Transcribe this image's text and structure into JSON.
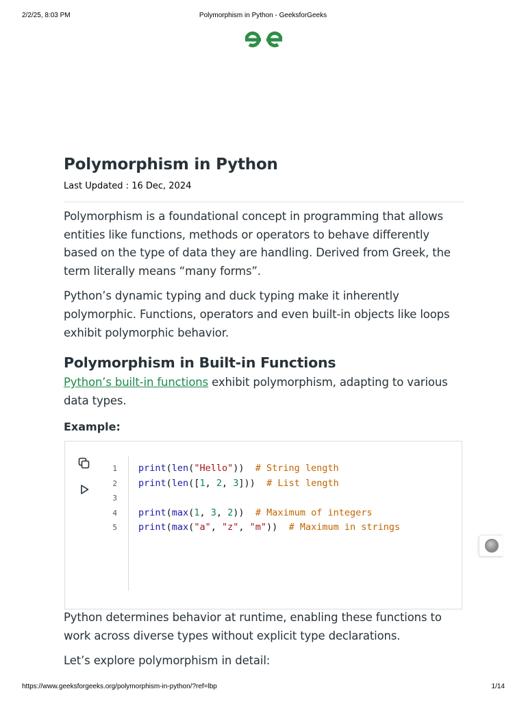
{
  "print_header": {
    "datetime": "2/2/25, 8:03 PM",
    "doc_title": "Polymorphism in Python - GeeksforGeeks"
  },
  "logo": {
    "icon": "geeksforgeeks-logo-icon",
    "color": "#2f8d46"
  },
  "article": {
    "title": "Polymorphism in Python",
    "last_updated": "Last Updated : 16 Dec, 2024",
    "paragraphs": [
      "Polymorphism is a foundational concept in programming that allows entities like functions, methods or operators to behave differently based on the type of data they are handling. Derived from Greek, the term literally means “many forms”.",
      "Python’s dynamic typing and duck typing make it inherently polymorphic. Functions, operators and even built-in objects like loops exhibit polymorphic behavior."
    ],
    "section": {
      "heading": "Polymorphism in Built-in Functions",
      "intro_link": "Python’s built-in functions",
      "intro_rest": " exhibit polymorphism, adapting to various data types.",
      "example_label": "Example:"
    }
  },
  "code_example": {
    "tools": {
      "copy_icon": "copy-icon",
      "run_icon": "play-icon"
    },
    "line_numbers": [
      "1",
      "2",
      "3",
      "4",
      "5"
    ],
    "colors": {
      "keyword": "#1a1aa6",
      "string": "#a31515",
      "number": "#098658",
      "comment": "#c26400"
    },
    "lines": [
      "print(len(\"Hello\"))  # String length",
      "print(len([1, 2, 3]))  # List length",
      "",
      "print(max(1, 3, 2))  # Maximum of integers",
      "print(max(\"a\", \"z\", \"m\"))  # Maximum in strings"
    ]
  },
  "after_code": {
    "paragraph": "Python determines behavior at runtime, enabling these functions to work across diverse types without explicit type declarations.",
    "explore": "Let’s explore polymorphism in detail:"
  },
  "floating_widget": {
    "icon": "feedback-icon"
  },
  "print_footer": {
    "url": "https://www.geeksforgeeks.org/polymorphism-in-python/?ref=lbp",
    "page": "1/14"
  }
}
